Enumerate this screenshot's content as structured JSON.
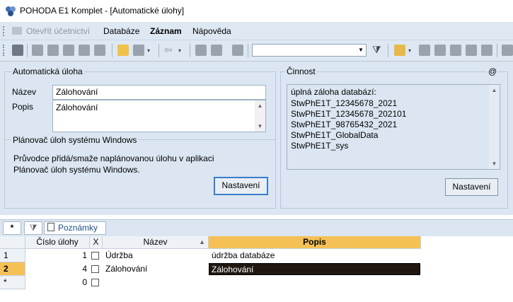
{
  "window": {
    "title": "POHODA E1 Komplet - [Automatické úlohy]"
  },
  "menu": {
    "open_accounting": "Otevřít účetnictví",
    "database": "Databáze",
    "record": "Záznam",
    "help": "Nápověda"
  },
  "task": {
    "group_title": "Automatická úloha",
    "name_label": "Název",
    "name_value": "Zálohování",
    "desc_label": "Popis",
    "desc_value": "Zálohování"
  },
  "scheduler": {
    "group_title": "Plánovač úloh systému Windows",
    "text_line1": "Průvodce přidá/smaže naplánovanou úlohu v aplikaci",
    "text_line2": "Plánovač úloh systému Windows.",
    "settings_button": "Nastavení"
  },
  "activity": {
    "group_title": "Činnost",
    "at_symbol": "@",
    "items": [
      "úplná záloha databází:",
      "StwPhE1T_12345678_2021",
      "StwPhE1T_12345678_202101",
      "StwPhE1T_98765432_2021",
      "StwPhE1T_GlobalData",
      "StwPhE1T_sys"
    ],
    "settings_button": "Nastavení"
  },
  "tabs": {
    "star": "*",
    "notes": "Poznámky"
  },
  "grid": {
    "columns": {
      "number": "Číslo úlohy",
      "x": "X",
      "name": "Název",
      "desc": "Popis"
    },
    "rows": [
      {
        "row_label": "1",
        "number": "1",
        "name": "Údržba",
        "desc": "údržba databáze"
      },
      {
        "row_label": "2",
        "number": "4",
        "name": "Zálohování",
        "desc": "Zálohování"
      },
      {
        "row_label": "*",
        "number": "0",
        "name": "",
        "desc": ""
      }
    ]
  },
  "colors": {
    "panel_bg": "#dbe6f2",
    "active_header": "#f5c156",
    "edit_cell_bg": "#1f1710"
  }
}
